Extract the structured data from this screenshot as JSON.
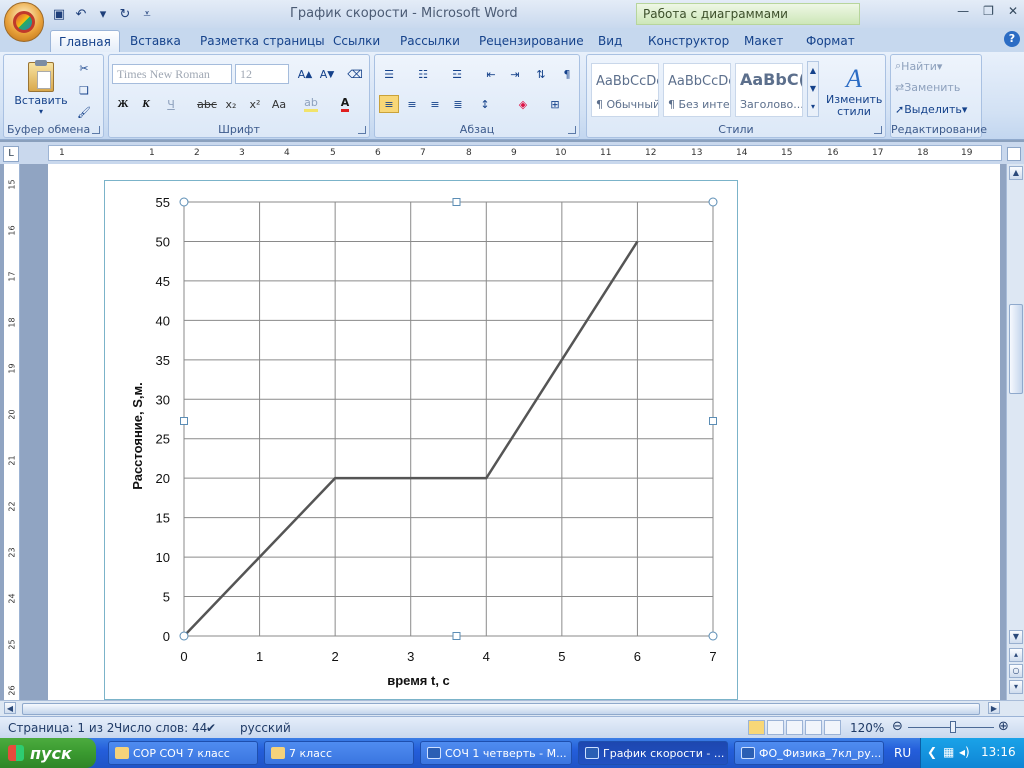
{
  "window": {
    "title": "График скорости - Microsoft Word",
    "context_tab_header": "Работа с диаграммами"
  },
  "tabs": [
    "Главная",
    "Вставка",
    "Разметка страницы",
    "Ссылки",
    "Рассылки",
    "Рецензирование",
    "Вид",
    "Конструктор",
    "Макет",
    "Формат"
  ],
  "ribbon": {
    "clipboard": {
      "paste_label": "Вставить",
      "group_label": "Буфер обмена"
    },
    "font": {
      "font_name": "Times New Roman",
      "font_size": "12",
      "group_label": "Шрифт",
      "bold": "Ж",
      "italic": "К",
      "underline": "Ч"
    },
    "paragraph": {
      "group_label": "Абзац"
    },
    "styles": {
      "group_label": "Стили",
      "cards": [
        {
          "sample": "AaBbCcDc",
          "name": "¶ Обычный"
        },
        {
          "sample": "AaBbCcDc",
          "name": "¶ Без инте..."
        },
        {
          "sample": "AaBbC(",
          "name": "Заголово..."
        }
      ],
      "change_styles": "Изменить стили"
    },
    "editing": {
      "group_label": "Редактирование",
      "find": "Найти",
      "replace": "Заменить",
      "select": "Выделить"
    }
  },
  "ruler": {
    "h_ticks": [
      "1",
      "1",
      "2",
      "3",
      "4",
      "5",
      "6",
      "7",
      "8",
      "9",
      "10",
      "11",
      "12",
      "13",
      "14",
      "15",
      "16",
      "17",
      "18",
      "19"
    ],
    "v_ticks": [
      "15",
      "16",
      "17",
      "18",
      "19",
      "20",
      "21",
      "22",
      "23",
      "24",
      "25",
      "26"
    ]
  },
  "chart_data": {
    "type": "line",
    "x": [
      0,
      2,
      4,
      6
    ],
    "series": [
      {
        "values": [
          0,
          20,
          20,
          50
        ]
      }
    ],
    "xlabel": "время t, с",
    "ylabel": "Расстояние, S,м.",
    "xlim": [
      0,
      7
    ],
    "ylim": [
      0,
      55
    ],
    "xticks": [
      "0",
      "1",
      "2",
      "3",
      "4",
      "5",
      "6",
      "7"
    ],
    "yticks": [
      "0",
      "5",
      "10",
      "15",
      "20",
      "25",
      "30",
      "35",
      "40",
      "45",
      "50",
      "55"
    ],
    "grid": true,
    "line_color": "#555555"
  },
  "status": {
    "page": "Страница: 1 из 2",
    "words": "Число слов: 44",
    "language": "русский",
    "zoom": "120%"
  },
  "taskbar": {
    "start": "пуск",
    "tasks": [
      "СОР СОЧ 7 класс",
      "7 класс",
      "СОЧ 1 четверть - М...",
      "График скорости - ...",
      "ФО_Физика_7кл_ру..."
    ],
    "lang": "RU",
    "time": "13:16"
  }
}
